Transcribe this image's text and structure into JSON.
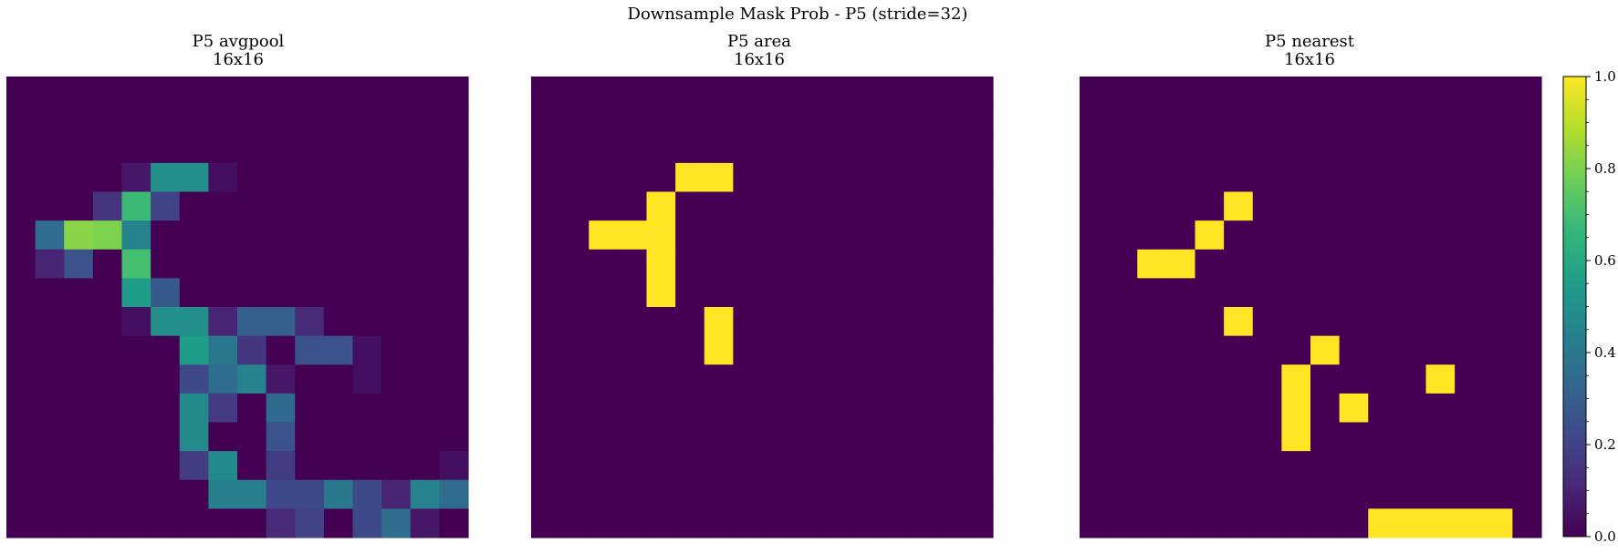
{
  "figure": {
    "title": "Downsample Mask Prob - P5 (stride=32)"
  },
  "chart_data": [
    {
      "type": "heatmap",
      "title": "P5 avgpool",
      "subtitle": "16x16",
      "rows": 16,
      "cols": 16,
      "vmin": 0,
      "vmax": 1,
      "colormap": "viridis",
      "values": [
        [
          0,
          0,
          0,
          0,
          0,
          0,
          0,
          0,
          0,
          0,
          0,
          0,
          0,
          0,
          0,
          0
        ],
        [
          0,
          0,
          0,
          0,
          0,
          0,
          0,
          0,
          0,
          0,
          0,
          0,
          0,
          0,
          0,
          0
        ],
        [
          0,
          0,
          0,
          0,
          0,
          0,
          0,
          0,
          0,
          0,
          0,
          0,
          0,
          0,
          0,
          0
        ],
        [
          0,
          0,
          0,
          0,
          0.06,
          0.5,
          0.5,
          0.04,
          0,
          0,
          0,
          0,
          0,
          0,
          0,
          0
        ],
        [
          0,
          0,
          0,
          0.15,
          0.68,
          0.2,
          0,
          0,
          0,
          0,
          0,
          0,
          0,
          0,
          0,
          0
        ],
        [
          0,
          0.35,
          0.82,
          0.8,
          0.45,
          0,
          0,
          0,
          0,
          0,
          0,
          0,
          0,
          0,
          0,
          0
        ],
        [
          0,
          0.1,
          0.25,
          0,
          0.7,
          0,
          0,
          0,
          0,
          0,
          0,
          0,
          0,
          0,
          0,
          0
        ],
        [
          0,
          0,
          0,
          0,
          0.55,
          0.28,
          0,
          0,
          0,
          0,
          0,
          0,
          0,
          0,
          0,
          0
        ],
        [
          0,
          0,
          0,
          0,
          0.04,
          0.5,
          0.5,
          0.1,
          0.3,
          0.3,
          0.12,
          0,
          0,
          0,
          0,
          0
        ],
        [
          0,
          0,
          0,
          0,
          0,
          0,
          0.55,
          0.4,
          0.16,
          0,
          0.25,
          0.25,
          0.04,
          0,
          0,
          0
        ],
        [
          0,
          0,
          0,
          0,
          0,
          0,
          0.22,
          0.35,
          0.45,
          0.06,
          0,
          0,
          0.04,
          0,
          0,
          0
        ],
        [
          0,
          0,
          0,
          0,
          0,
          0,
          0.48,
          0.17,
          0,
          0.34,
          0,
          0,
          0,
          0,
          0,
          0
        ],
        [
          0,
          0,
          0,
          0,
          0,
          0,
          0.48,
          0,
          0,
          0.25,
          0,
          0,
          0,
          0,
          0,
          0
        ],
        [
          0,
          0,
          0,
          0,
          0,
          0,
          0.18,
          0.48,
          0,
          0.18,
          0,
          0,
          0,
          0,
          0,
          0.04
        ],
        [
          0,
          0,
          0,
          0,
          0,
          0,
          0,
          0.43,
          0.43,
          0.22,
          0.22,
          0.4,
          0.22,
          0.1,
          0.45,
          0.35
        ],
        [
          0,
          0,
          0,
          0,
          0,
          0,
          0,
          0,
          0,
          0.12,
          0.2,
          0,
          0.22,
          0.35,
          0.06,
          0
        ]
      ]
    },
    {
      "type": "heatmap",
      "title": "P5 area",
      "subtitle": "16x16",
      "rows": 16,
      "cols": 16,
      "vmin": 0,
      "vmax": 1,
      "colormap": "viridis",
      "values": [
        [
          0,
          0,
          0,
          0,
          0,
          0,
          0,
          0,
          0,
          0,
          0,
          0,
          0,
          0,
          0,
          0
        ],
        [
          0,
          0,
          0,
          0,
          0,
          0,
          0,
          0,
          0,
          0,
          0,
          0,
          0,
          0,
          0,
          0
        ],
        [
          0,
          0,
          0,
          0,
          0,
          0,
          0,
          0,
          0,
          0,
          0,
          0,
          0,
          0,
          0,
          0
        ],
        [
          0,
          0,
          0,
          0,
          0,
          1,
          1,
          0,
          0,
          0,
          0,
          0,
          0,
          0,
          0,
          0
        ],
        [
          0,
          0,
          0,
          0,
          1,
          0,
          0,
          0,
          0,
          0,
          0,
          0,
          0,
          0,
          0,
          0
        ],
        [
          0,
          0,
          1,
          1,
          1,
          0,
          0,
          0,
          0,
          0,
          0,
          0,
          0,
          0,
          0,
          0
        ],
        [
          0,
          0,
          0,
          0,
          1,
          0,
          0,
          0,
          0,
          0,
          0,
          0,
          0,
          0,
          0,
          0
        ],
        [
          0,
          0,
          0,
          0,
          1,
          0,
          0,
          0,
          0,
          0,
          0,
          0,
          0,
          0,
          0,
          0
        ],
        [
          0,
          0,
          0,
          0,
          0,
          0,
          1,
          0,
          0,
          0,
          0,
          0,
          0,
          0,
          0,
          0
        ],
        [
          0,
          0,
          0,
          0,
          0,
          0,
          1,
          0,
          0,
          0,
          0,
          0,
          0,
          0,
          0,
          0
        ],
        [
          0,
          0,
          0,
          0,
          0,
          0,
          0,
          0,
          0,
          0,
          0,
          0,
          0,
          0,
          0,
          0
        ],
        [
          0,
          0,
          0,
          0,
          0,
          0,
          0,
          0,
          0,
          0,
          0,
          0,
          0,
          0,
          0,
          0
        ],
        [
          0,
          0,
          0,
          0,
          0,
          0,
          0,
          0,
          0,
          0,
          0,
          0,
          0,
          0,
          0,
          0
        ],
        [
          0,
          0,
          0,
          0,
          0,
          0,
          0,
          0,
          0,
          0,
          0,
          0,
          0,
          0,
          0,
          0
        ],
        [
          0,
          0,
          0,
          0,
          0,
          0,
          0,
          0,
          0,
          0,
          0,
          0,
          0,
          0,
          0,
          0
        ],
        [
          0,
          0,
          0,
          0,
          0,
          0,
          0,
          0,
          0,
          0,
          0,
          0,
          0,
          0,
          0,
          0
        ]
      ]
    },
    {
      "type": "heatmap",
      "title": "P5 nearest",
      "subtitle": "16x16",
      "rows": 16,
      "cols": 16,
      "vmin": 0,
      "vmax": 1,
      "colormap": "viridis",
      "values": [
        [
          0,
          0,
          0,
          0,
          0,
          0,
          0,
          0,
          0,
          0,
          0,
          0,
          0,
          0,
          0,
          0
        ],
        [
          0,
          0,
          0,
          0,
          0,
          0,
          0,
          0,
          0,
          0,
          0,
          0,
          0,
          0,
          0,
          0
        ],
        [
          0,
          0,
          0,
          0,
          0,
          0,
          0,
          0,
          0,
          0,
          0,
          0,
          0,
          0,
          0,
          0
        ],
        [
          0,
          0,
          0,
          0,
          0,
          0,
          0,
          0,
          0,
          0,
          0,
          0,
          0,
          0,
          0,
          0
        ],
        [
          0,
          0,
          0,
          0,
          0,
          1,
          0,
          0,
          0,
          0,
          0,
          0,
          0,
          0,
          0,
          0
        ],
        [
          0,
          0,
          0,
          0,
          1,
          0,
          0,
          0,
          0,
          0,
          0,
          0,
          0,
          0,
          0,
          0
        ],
        [
          0,
          0,
          1,
          1,
          0,
          0,
          0,
          0,
          0,
          0,
          0,
          0,
          0,
          0,
          0,
          0
        ],
        [
          0,
          0,
          0,
          0,
          0,
          0,
          0,
          0,
          0,
          0,
          0,
          0,
          0,
          0,
          0,
          0
        ],
        [
          0,
          0,
          0,
          0,
          0,
          1,
          0,
          0,
          0,
          0,
          0,
          0,
          0,
          0,
          0,
          0
        ],
        [
          0,
          0,
          0,
          0,
          0,
          0,
          0,
          0,
          1,
          0,
          0,
          0,
          0,
          0,
          0,
          0
        ],
        [
          0,
          0,
          0,
          0,
          0,
          0,
          0,
          1,
          0,
          0,
          0,
          0,
          1,
          0,
          0,
          0
        ],
        [
          0,
          0,
          0,
          0,
          0,
          0,
          0,
          1,
          0,
          1,
          0,
          0,
          0,
          0,
          0,
          0
        ],
        [
          0,
          0,
          0,
          0,
          0,
          0,
          0,
          1,
          0,
          0,
          0,
          0,
          0,
          0,
          0,
          0
        ],
        [
          0,
          0,
          0,
          0,
          0,
          0,
          0,
          0,
          0,
          0,
          0,
          0,
          0,
          0,
          0,
          0
        ],
        [
          0,
          0,
          0,
          0,
          0,
          0,
          0,
          0,
          0,
          0,
          0,
          0,
          0,
          0,
          0,
          0
        ],
        [
          0,
          0,
          0,
          0,
          0,
          0,
          0,
          0,
          0,
          0,
          1,
          1,
          1,
          1,
          1,
          0
        ]
      ]
    }
  ],
  "colorbar": {
    "min": 0,
    "max": 1,
    "tick_labels": [
      "0.0",
      "0.2",
      "0.4",
      "0.6",
      "0.8",
      "1.0"
    ],
    "colors": [
      "#440154",
      "#482878",
      "#3e4a89",
      "#31688e",
      "#26828e",
      "#1f9e89",
      "#35b779",
      "#6ece58",
      "#b5de2b",
      "#fde725"
    ]
  }
}
